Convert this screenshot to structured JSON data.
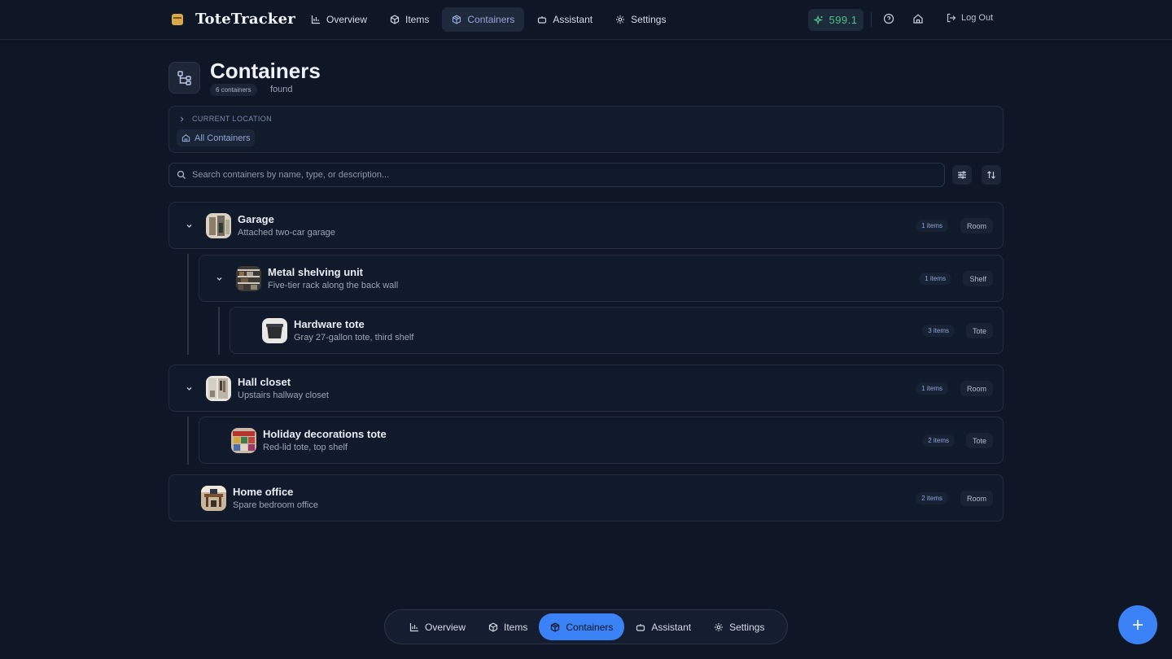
{
  "app": {
    "name": "ToteTracker",
    "score": "599.1",
    "logout_label": "Log Out"
  },
  "nav": [
    {
      "label": "Overview",
      "icon": "bar-chart-icon",
      "active": false
    },
    {
      "label": "Items",
      "icon": "cube-icon",
      "active": false
    },
    {
      "label": "Containers",
      "icon": "box-icon",
      "active": true
    },
    {
      "label": "Assistant",
      "icon": "robot-icon",
      "active": false
    },
    {
      "label": "Settings",
      "icon": "gear-icon",
      "active": false
    }
  ],
  "page": {
    "title": "Containers",
    "count_badge": "6 containers",
    "count_suffix": "found"
  },
  "location": {
    "heading": "CURRENT LOCATION",
    "chip": "All Containers"
  },
  "search": {
    "placeholder": "Search containers by name, type, or description..."
  },
  "containers": [
    {
      "name": "Garage",
      "description": "Attached two-car garage",
      "count": "1 items",
      "type": "Room",
      "expandable": true
    },
    {
      "name": "Metal shelving unit",
      "description": "Five-tier rack along the back wall",
      "count": "1 items",
      "type": "Shelf",
      "expandable": true
    },
    {
      "name": "Hardware tote",
      "description": "Gray 27-gallon tote, third shelf",
      "count": "3 items",
      "type": "Tote",
      "expandable": false
    },
    {
      "name": "Hall closet",
      "description": "Upstairs hallway closet",
      "count": "1 items",
      "type": "Room",
      "expandable": true
    },
    {
      "name": "Holiday decorations tote",
      "description": "Red-lid tote, top shelf",
      "count": "2 items",
      "type": "Tote",
      "expandable": false
    },
    {
      "name": "Home office",
      "description": "Spare bedroom office",
      "count": "2 items",
      "type": "Room",
      "expandable": false
    }
  ],
  "dock": [
    {
      "label": "Overview",
      "icon": "bar-chart-icon",
      "active": false
    },
    {
      "label": "Items",
      "icon": "cube-icon",
      "active": false
    },
    {
      "label": "Containers",
      "icon": "box-icon",
      "active": true
    },
    {
      "label": "Assistant",
      "icon": "robot-icon",
      "active": false
    },
    {
      "label": "Settings",
      "icon": "gear-icon",
      "active": false
    }
  ],
  "colors": {
    "accent": "#3b82f6",
    "background": "#0f1727",
    "score": "#4cc08b",
    "brand": "#d9a84a"
  }
}
